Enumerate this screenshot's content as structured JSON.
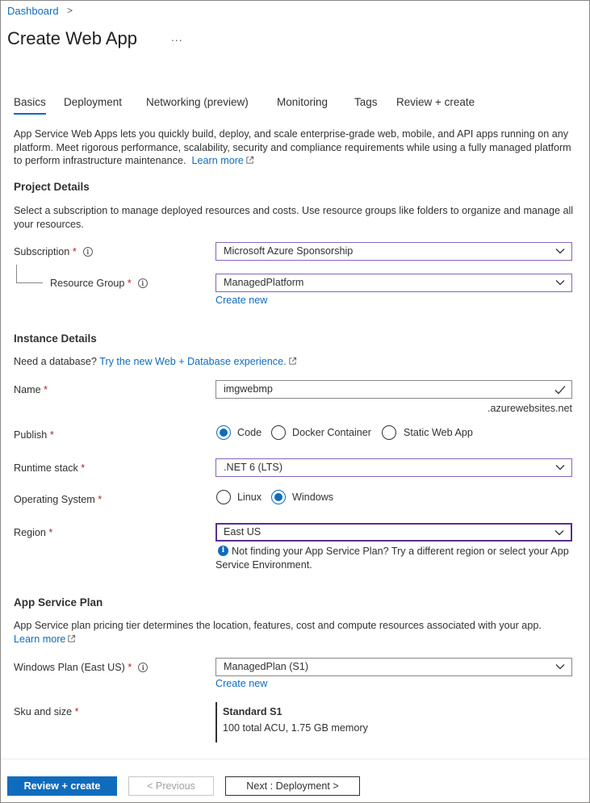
{
  "breadcrumb": {
    "root": "Dashboard",
    "separator": ">"
  },
  "page": {
    "title": "Create Web App",
    "more": "..."
  },
  "tabs": [
    {
      "label": "Basics",
      "active": true
    },
    {
      "label": "Deployment"
    },
    {
      "label": "Networking (preview)"
    },
    {
      "label": "Monitoring"
    },
    {
      "label": "Tags"
    },
    {
      "label": "Review + create"
    }
  ],
  "intro": {
    "text": "App Service Web Apps lets you quickly build, deploy, and scale enterprise-grade web, mobile, and API apps running on any platform. Meet rigorous performance, scalability, security and compliance requirements while using a fully managed platform to perform infrastructure maintenance.",
    "learn_more": "Learn more"
  },
  "project": {
    "heading": "Project Details",
    "description": "Select a subscription to manage deployed resources and costs. Use resource groups like folders to organize and manage all your resources.",
    "subscription_label": "Subscription",
    "subscription_value": "Microsoft Azure Sponsorship",
    "resource_group_label": "Resource Group",
    "resource_group_value": "ManagedPlatform",
    "create_new": "Create new"
  },
  "instance": {
    "heading": "Instance Details",
    "db_prompt": "Need a database?",
    "db_link": "Try the new Web + Database experience.",
    "name_label": "Name",
    "name_value": "imgwebmp",
    "name_suffix": ".azurewebsites.net",
    "publish_label": "Publish",
    "publish_options": [
      "Code",
      "Docker Container",
      "Static Web App"
    ],
    "publish_selected": "Code",
    "runtime_label": "Runtime stack",
    "runtime_value": ".NET 6 (LTS)",
    "os_label": "Operating System",
    "os_options": [
      "Linux",
      "Windows"
    ],
    "os_selected": "Windows",
    "region_label": "Region",
    "region_value": "East US",
    "region_note": "Not finding your App Service Plan? Try a different region or select your App Service Environment."
  },
  "plan": {
    "heading": "App Service Plan",
    "description": "App Service plan pricing tier determines the location, features, cost and compute resources associated with your app.",
    "learn_more": "Learn more",
    "windows_plan_label": "Windows Plan (East US)",
    "windows_plan_value": "ManagedPlan (S1)",
    "create_new": "Create new",
    "sku_label": "Sku and size",
    "sku_name": "Standard S1",
    "sku_detail": "100 total ACU, 1.75 GB memory"
  },
  "footer": {
    "review_create": "Review + create",
    "previous": "< Previous",
    "next": "Next : Deployment >"
  },
  "colors": {
    "accent": "#0f6cbd",
    "required": "#a4262c",
    "focus": "#5c2e91"
  },
  "icons": [
    "chevron-right-icon",
    "more-icon",
    "info-icon",
    "external-link-icon",
    "chevron-down-icon",
    "checkmark-icon",
    "info-filled-icon"
  ]
}
